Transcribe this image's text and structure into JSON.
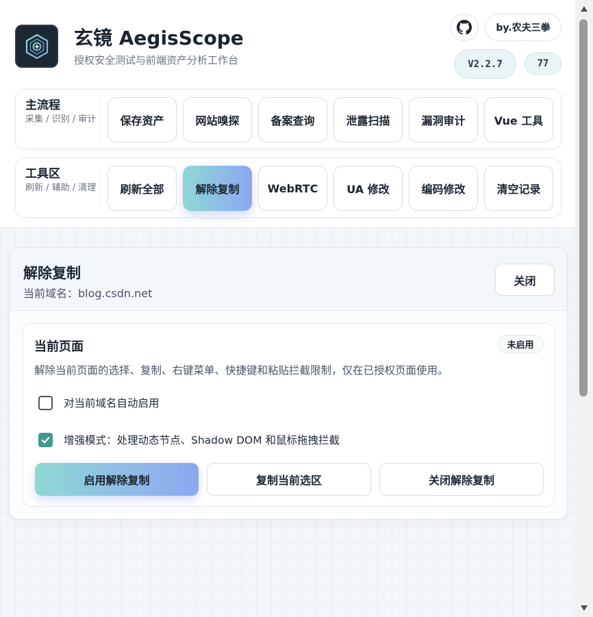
{
  "header": {
    "title": "玄镜 AegisScope",
    "subtitle": "授权安全测试与前端资产分析工作台",
    "author_button": "by.农夫三拳",
    "version": "V2.2.7",
    "count": "77",
    "github_icon": "github-icon",
    "logo_icon": "aegis-shield-icon"
  },
  "rows": [
    {
      "title": "主流程",
      "desc": "采集 / 识别 / 审计",
      "buttons": [
        "保存资产",
        "网站嗅探",
        "备案查询",
        "泄露扫描",
        "漏洞审计",
        "Vue 工具"
      ]
    },
    {
      "title": "工具区",
      "desc": "刷新 / 辅助 / 清理",
      "buttons": [
        "刷新全部",
        "解除复制",
        "WebRTC",
        "UA 修改",
        "编码修改",
        "清空记录"
      ],
      "active_index": 1
    }
  ],
  "panel": {
    "title": "解除复制",
    "domain": "当前域名：blog.csdn.net",
    "close_button": "关闭",
    "section": {
      "title": "当前页面",
      "status": "未启用",
      "description": "解除当前页面的选择、复制、右键菜单、快捷键和粘贴拦截限制，仅在已授权页面使用。",
      "options": [
        {
          "label": "对当前域名自动启用",
          "checked": false
        },
        {
          "label": "增强模式：处理动态节点、Shadow DOM 和鼠标拖拽拦截",
          "checked": true
        }
      ],
      "actions": [
        "启用解除复制",
        "复制当前选区",
        "关闭解除复制"
      ]
    }
  },
  "colors": {
    "accent_gradient_start": "#8fd8d4",
    "accent_gradient_end": "#8da7f3",
    "checkbox_checked": "#3f9991",
    "logo_bg": "#1d2733"
  }
}
